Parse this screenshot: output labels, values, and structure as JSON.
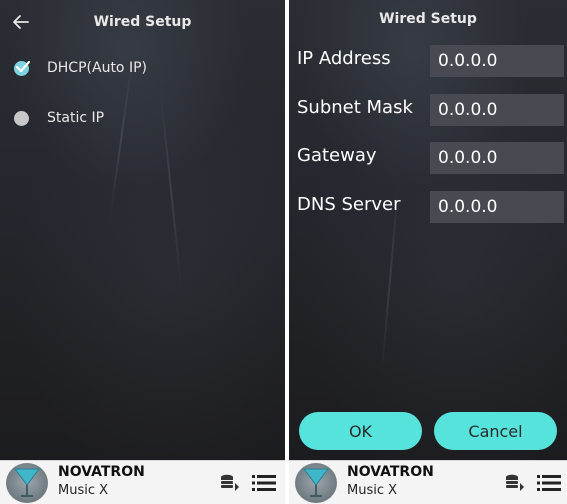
{
  "colors": {
    "accent": "#56e3dc",
    "checked": "#7fd3e0",
    "input_bg": "#474a50",
    "footer_bg": "#f4f4f4"
  },
  "left_screen": {
    "title": "Wired Setup",
    "back_icon": "back-arrow-icon",
    "options": [
      {
        "label": "DHCP(Auto IP)",
        "selected": true
      },
      {
        "label": "Static IP",
        "selected": false
      }
    ]
  },
  "right_screen": {
    "title": "Wired Setup",
    "fields": [
      {
        "label": "IP Address",
        "value": "0.0.0.0"
      },
      {
        "label": "Subnet Mask",
        "value": "0.0.0.0"
      },
      {
        "label": "Gateway",
        "value": "0.0.0.0"
      },
      {
        "label": "DNS Server",
        "value": "0.0.0.0"
      }
    ],
    "ok_label": "OK",
    "cancel_label": "Cancel"
  },
  "player": {
    "brand": "NOVATRON",
    "model": "Music X",
    "icons": [
      "playlist-queue-icon",
      "menu-list-icon"
    ]
  }
}
